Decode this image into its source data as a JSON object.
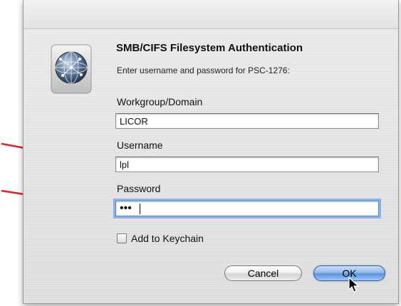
{
  "dialog": {
    "title": "SMB/CIFS Filesystem Authentication",
    "subtitle": "Enter username and password for PSC-1276:",
    "icon": "network-globe-icon"
  },
  "fields": {
    "workgroup": {
      "label": "Workgroup/Domain",
      "value": "LICOR"
    },
    "username": {
      "label": "Username",
      "value": "lpl"
    },
    "password": {
      "label": "Password",
      "masked_value": "•••"
    }
  },
  "keychain": {
    "label": "Add to Keychain",
    "checked": false
  },
  "buttons": {
    "cancel": "Cancel",
    "ok": "OK"
  },
  "annotations": {
    "arrow_color": "#e0202a",
    "arrow_count": 2
  },
  "colors": {
    "focus_ring": "#8ab1ea",
    "default_button": "#5c93df"
  }
}
